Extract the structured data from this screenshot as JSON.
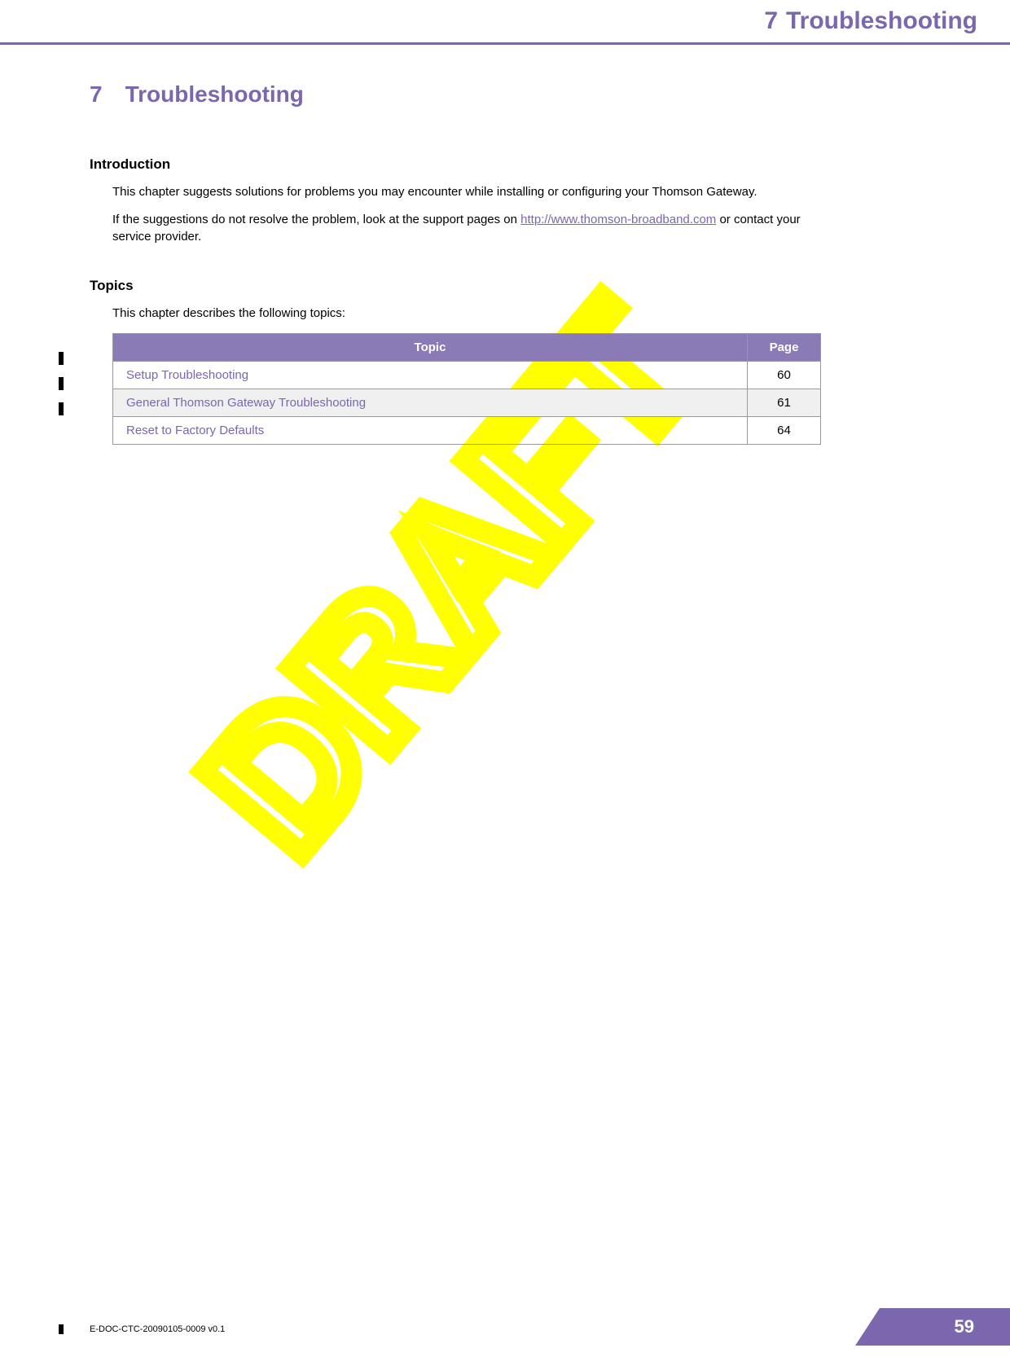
{
  "header": {
    "chapter_number": "7",
    "chapter_title": "Troubleshooting"
  },
  "chapter": {
    "number": "7",
    "title": "Troubleshooting"
  },
  "intro": {
    "heading": "Introduction",
    "p1": "This chapter suggests solutions for problems you may encounter while installing or configuring your Thomson Gateway.",
    "p2_a": "If the suggestions do not resolve the problem, look at the support pages on ",
    "p2_link": "http://www.thomson-broadband.com",
    "p2_b": " or contact your service provider."
  },
  "topics": {
    "heading": "Topics",
    "intro": "This chapter describes the following topics:",
    "col_topic": "Topic",
    "col_page": "Page",
    "rows": [
      {
        "topic": "Setup Troubleshooting",
        "page": "60"
      },
      {
        "topic": "General Thomson Gateway Troubleshooting",
        "page": "61"
      },
      {
        "topic": "Reset to Factory Defaults",
        "page": "64"
      }
    ]
  },
  "footer": {
    "doc_id": "E-DOC-CTC-20090105-0009 v0.1",
    "page_number": "59"
  },
  "watermark": "DRAFT"
}
